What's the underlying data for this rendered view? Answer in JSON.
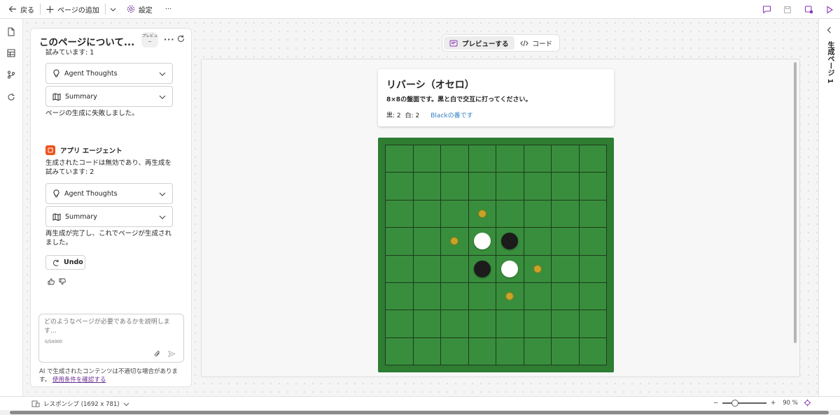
{
  "topbar": {
    "back_label": "戻る",
    "add_page_label": "ページの追加",
    "settings_label": "設定",
    "more_label": "···"
  },
  "chat": {
    "title": "このページについて...",
    "preview_badge": "プレビュー",
    "attempt_1_text": "試みています: 1",
    "agent_thoughts_label_1": "Agent Thoughts",
    "summary_label_1": "Summary",
    "fail_text": "ページの生成に失敗しました。",
    "agent_name": "アプリ エージェント",
    "regen_text_line1": "生成されたコードは無効であり、再生成を",
    "regen_text_line2": "試みています: 2",
    "agent_thoughts_label_2": "Agent Thoughts",
    "summary_label_2": "Summary",
    "complete_text_line1": "再生成が完了し、これでページが生成され",
    "complete_text_line2": "ました。",
    "undo_label": "Undo",
    "input_placeholder": "どのようなページが必要であるかを説明します...",
    "input_count": "0/50000",
    "disclaimer": "AI で生成されたコンテンツは不適切な場合があります。",
    "terms_link": "使用条件を確認する"
  },
  "toggle": {
    "preview_label": "プレビューする",
    "code_label": "コード"
  },
  "game": {
    "title": "リバーシ（オセロ）",
    "description": "8×8の盤面です。黒と白で交互に打ってください。",
    "black_score": "黒: 2",
    "white_score": "白: 2",
    "turn_text": "Blackの番です",
    "board": [
      [
        "",
        "",
        "",
        "",
        "",
        "",
        "",
        ""
      ],
      [
        "",
        "",
        "",
        "",
        "",
        "",
        "",
        ""
      ],
      [
        "",
        "",
        "",
        "h",
        "",
        "",
        "",
        ""
      ],
      [
        "",
        "",
        "h",
        "W",
        "B",
        "",
        "",
        ""
      ],
      [
        "",
        "",
        "",
        "B",
        "W",
        "h",
        "",
        ""
      ],
      [
        "",
        "",
        "",
        "",
        "h",
        "",
        "",
        ""
      ],
      [
        "",
        "",
        "",
        "",
        "",
        "",
        "",
        ""
      ],
      [
        "",
        "",
        "",
        "",
        "",
        "",
        "",
        ""
      ]
    ],
    "colors": {
      "board": "#2e7d32",
      "cell": "#388e3c",
      "hint": "#c9a227"
    }
  },
  "rightrail": {
    "page_label": "生成ページ 1"
  },
  "bottombar": {
    "responsive_label": "レスポンシブ (1692 x 781)",
    "zoom_minus": "−",
    "zoom_plus": "+",
    "zoom_level": "90 %",
    "zoom_fraction": 0.2
  },
  "accent": "#8a3ab9"
}
